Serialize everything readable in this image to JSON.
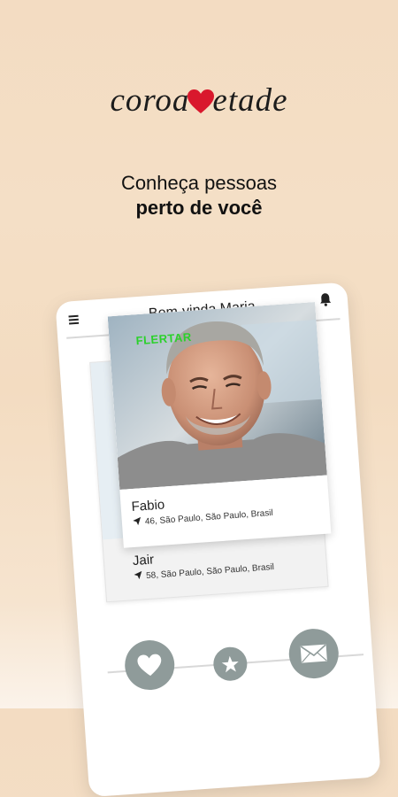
{
  "brand": {
    "logo_left": "coroa",
    "logo_right": "etade"
  },
  "headline": {
    "line1": "Conheça pessoas",
    "line2": "perto de você"
  },
  "app": {
    "title": "Bem-vinda Maria",
    "front_card": {
      "badge": "FLERTAR",
      "name": "Fabio",
      "location": "46, São Paulo, São Paulo, Brasil"
    },
    "back_card": {
      "name": "Jair",
      "location": "58, São Paulo, São Paulo, Brasil"
    },
    "actions": [
      "heart-icon",
      "star-icon",
      "mail-icon"
    ]
  },
  "colors": {
    "accent_red": "#d9182d",
    "flertar_green": "#2bd12b",
    "action_gray": "#8f9b9a"
  }
}
